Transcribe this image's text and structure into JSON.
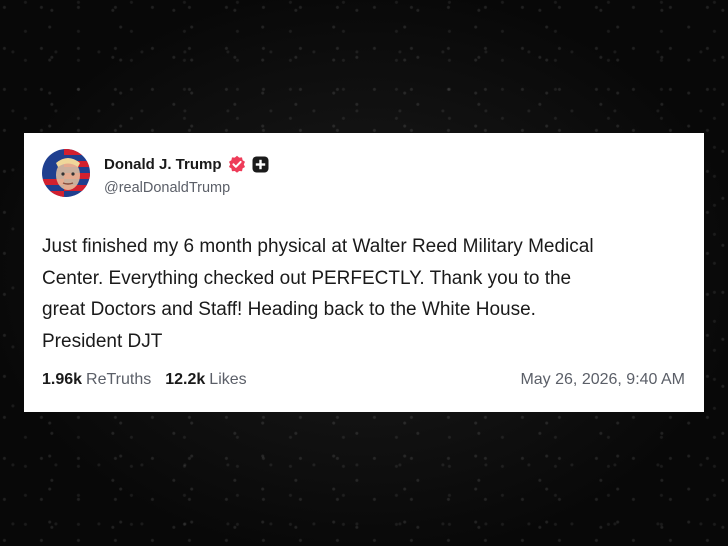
{
  "post": {
    "author": {
      "display_name": "Donald J. Trump",
      "handle": "@realDonaldTrump",
      "verified_icon": "verified-badge-icon",
      "extra_icon": "plus-icon",
      "badge_color": "#ee3c59"
    },
    "body_lines": [
      "Just finished my 6 month physical at Walter Reed Military Medical",
      "Center. Everything checked out PERFECTLY. Thank you to the",
      "great Doctors and Staff! Heading back to the White House.",
      "President DJT"
    ],
    "stats": {
      "retruths_count": "1.96k",
      "retruths_label": "ReTruths",
      "likes_count": "12.2k",
      "likes_label": "Likes"
    },
    "timestamp": "May 26, 2026, 9:40 AM"
  }
}
